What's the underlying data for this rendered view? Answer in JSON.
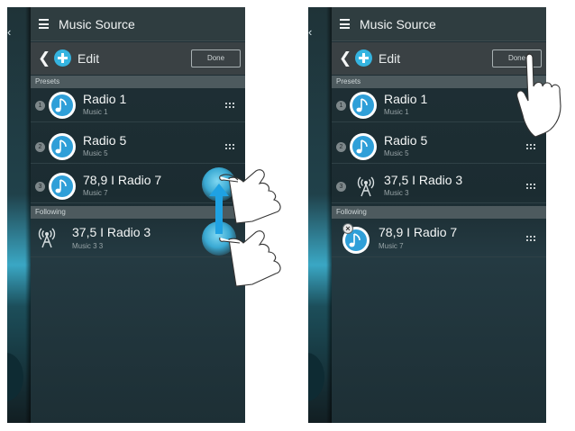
{
  "screens": [
    {
      "title": "Music Source",
      "edit_label": "Edit",
      "done_label": "Done",
      "presets_header": "Presets",
      "following_header": "Following",
      "presets": [
        {
          "number": "1",
          "name": "Radio 1",
          "sub": "Music 1"
        },
        {
          "number": "2",
          "name": "Radio 5",
          "sub": "Music 5"
        },
        {
          "number": "3",
          "name": "78,9 I Radio 7",
          "sub": "Music 7"
        }
      ],
      "following": [
        {
          "name": "37,5 I Radio 3",
          "sub": "Music 3   3"
        }
      ]
    },
    {
      "title": "Music Source",
      "edit_label": "Edit",
      "done_label": "Done",
      "presets_header": "Presets",
      "following_header": "Following",
      "presets": [
        {
          "number": "1",
          "name": "Radio 1",
          "sub": "Music 1"
        },
        {
          "number": "2",
          "name": "Radio 5",
          "sub": "Music 5"
        },
        {
          "number": "3",
          "name": "37,5 I Radio 3",
          "sub": "Music 3"
        }
      ],
      "following": [
        {
          "name": "78,9 I Radio 7",
          "sub": "Music 7"
        }
      ]
    }
  ],
  "icons": {
    "menu": "hamburger-icon",
    "back": "chevron-left-icon",
    "edit": "edit-plus-icon",
    "music": "music-note-icon",
    "antenna": "radio-antenna-icon",
    "grip": "drag-handle-icon",
    "delete": "delete-x-icon",
    "hand": "hand-pointer-icon",
    "arrow": "arrow-up-icon"
  },
  "colors": {
    "accent": "#35b4e0",
    "disc": "#2f9fd8",
    "titlebar": "#2f3d40",
    "section": "#4d5a5e"
  }
}
